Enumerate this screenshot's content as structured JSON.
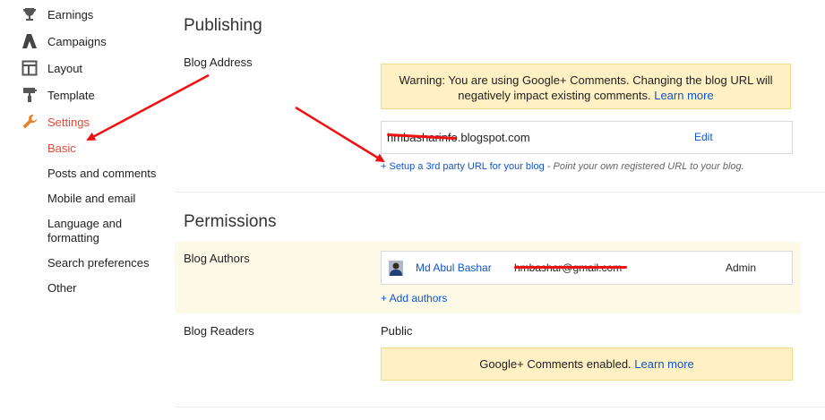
{
  "sidebar": {
    "items": [
      {
        "label": "Earnings",
        "icon": "trophy-icon"
      },
      {
        "label": "Campaigns",
        "icon": "adwords-icon"
      },
      {
        "label": "Layout",
        "icon": "layout-icon"
      },
      {
        "label": "Template",
        "icon": "paint-roller-icon"
      },
      {
        "label": "Settings",
        "icon": "wrench-icon"
      }
    ],
    "settings_sub": [
      "Basic",
      "Posts and comments",
      "Mobile and email",
      "Language and formatting",
      "Search preferences",
      "Other"
    ]
  },
  "publishing": {
    "title": "Publishing",
    "blog_address_label": "Blog Address",
    "warning_text": "Warning: You are using Google+ Comments. Changing the blog URL will negatively impact existing comments.",
    "learn_more": "Learn more",
    "address": "hmbasharinfo.blogspot.com",
    "edit": "Edit",
    "setup_link": "+ Setup a 3rd party URL for your blog",
    "setup_hint": "- Point your own registered URL to your blog."
  },
  "permissions": {
    "title": "Permissions",
    "authors_label": "Blog Authors",
    "author": {
      "name": "Md Abul Bashar",
      "email": "hmbashar@gmail.com",
      "role": "Admin"
    },
    "add_authors": "+ Add authors",
    "readers_label": "Blog Readers",
    "readers_value": "Public",
    "gplus_text": "Google+ Comments enabled.",
    "learn_more": "Learn more"
  },
  "colors": {
    "accent": "#dd4b39",
    "link": "#1155cc",
    "warning_bg": "#fff1c4",
    "annotation": "#ee1111"
  }
}
